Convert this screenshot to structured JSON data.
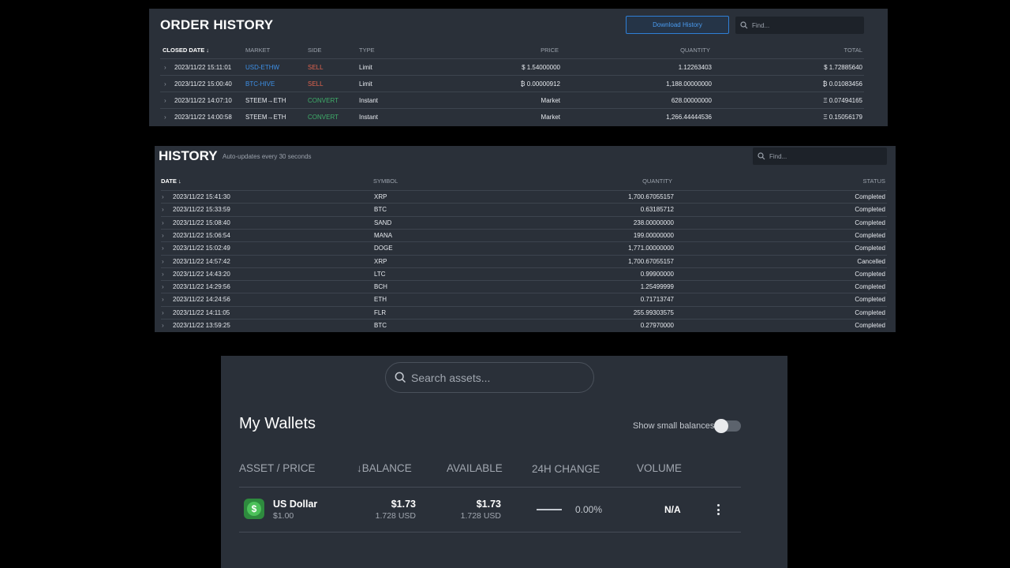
{
  "order_history": {
    "title": "ORDER HISTORY",
    "download_label": "Download History",
    "find_placeholder": "Find...",
    "columns": [
      "CLOSED DATE",
      "MARKET",
      "SIDE",
      "TYPE",
      "PRICE",
      "QUANTITY",
      "TOTAL"
    ],
    "rows": [
      {
        "date": "2023/11/22 15:11:01",
        "market": "USD-ETHW",
        "side": "SELL",
        "type": "Limit",
        "price": "$ 1.54000000",
        "quantity": "1.12263403",
        "total": "$ 1.72885640"
      },
      {
        "date": "2023/11/22 15:00:40",
        "market": "BTC-HIVE",
        "side": "SELL",
        "type": "Limit",
        "price": "₿ 0.00000912",
        "quantity": "1,188.00000000",
        "total": "₿ 0.01083456"
      },
      {
        "date": "2023/11/22 14:07:10",
        "market": "STEEM→ETH",
        "side": "CONVERT",
        "type": "Instant",
        "price": "Market",
        "quantity": "628.00000000",
        "total": "Ξ 0.07494165"
      },
      {
        "date": "2023/11/22 14:00:58",
        "market": "STEEM→ETH",
        "side": "CONVERT",
        "type": "Instant",
        "price": "Market",
        "quantity": "1,266.44444536",
        "total": "Ξ 0.15056179"
      }
    ]
  },
  "history": {
    "title": "HISTORY",
    "subtitle": "Auto-updates every 30 seconds",
    "find_placeholder": "Find...",
    "columns": [
      "DATE",
      "SYMBOL",
      "QUANTITY",
      "STATUS"
    ],
    "rows": [
      {
        "date": "2023/11/22 15:41:30",
        "symbol": "XRP",
        "quantity": "1,700.67055157",
        "status": "Completed"
      },
      {
        "date": "2023/11/22 15:33:59",
        "symbol": "BTC",
        "quantity": "0.63185712",
        "status": "Completed"
      },
      {
        "date": "2023/11/22 15:08:40",
        "symbol": "SAND",
        "quantity": "238.00000000",
        "status": "Completed"
      },
      {
        "date": "2023/11/22 15:06:54",
        "symbol": "MANA",
        "quantity": "199.00000000",
        "status": "Completed"
      },
      {
        "date": "2023/11/22 15:02:49",
        "symbol": "DOGE",
        "quantity": "1,771.00000000",
        "status": "Completed"
      },
      {
        "date": "2023/11/22 14:57:42",
        "symbol": "XRP",
        "quantity": "1,700.67055157",
        "status": "Cancelled"
      },
      {
        "date": "2023/11/22 14:43:20",
        "symbol": "LTC",
        "quantity": "0.99900000",
        "status": "Completed"
      },
      {
        "date": "2023/11/22 14:29:56",
        "symbol": "BCH",
        "quantity": "1.25499999",
        "status": "Completed"
      },
      {
        "date": "2023/11/22 14:24:56",
        "symbol": "ETH",
        "quantity": "0.71713747",
        "status": "Completed"
      },
      {
        "date": "2023/11/22 14:11:05",
        "symbol": "FLR",
        "quantity": "255.99303575",
        "status": "Completed"
      },
      {
        "date": "2023/11/22 13:59:25",
        "symbol": "BTC",
        "quantity": "0.27970000",
        "status": "Completed"
      }
    ]
  },
  "wallets": {
    "search_placeholder": "Search assets...",
    "title": "My Wallets",
    "toggle_label": "Show small balances",
    "toggle_on": false,
    "columns": [
      "ASSET / PRICE",
      "BALANCE",
      "AVAILABLE",
      "24H CHANGE",
      "VOLUME"
    ],
    "rows": [
      {
        "name": "US Dollar",
        "price": "$1.00",
        "balance": "$1.73",
        "balance_sub": "1.728 USD",
        "available": "$1.73",
        "available_sub": "1.728 USD",
        "change": "0.00%",
        "volume": "N/A",
        "icon": "dollar-icon"
      }
    ]
  },
  "colors": {
    "panel_bg": "#2a3039",
    "accent_blue": "#3d8fe6",
    "sell_red": "#e0634e",
    "convert_green": "#3fae6a",
    "dollar_green": "#4cc15a"
  }
}
